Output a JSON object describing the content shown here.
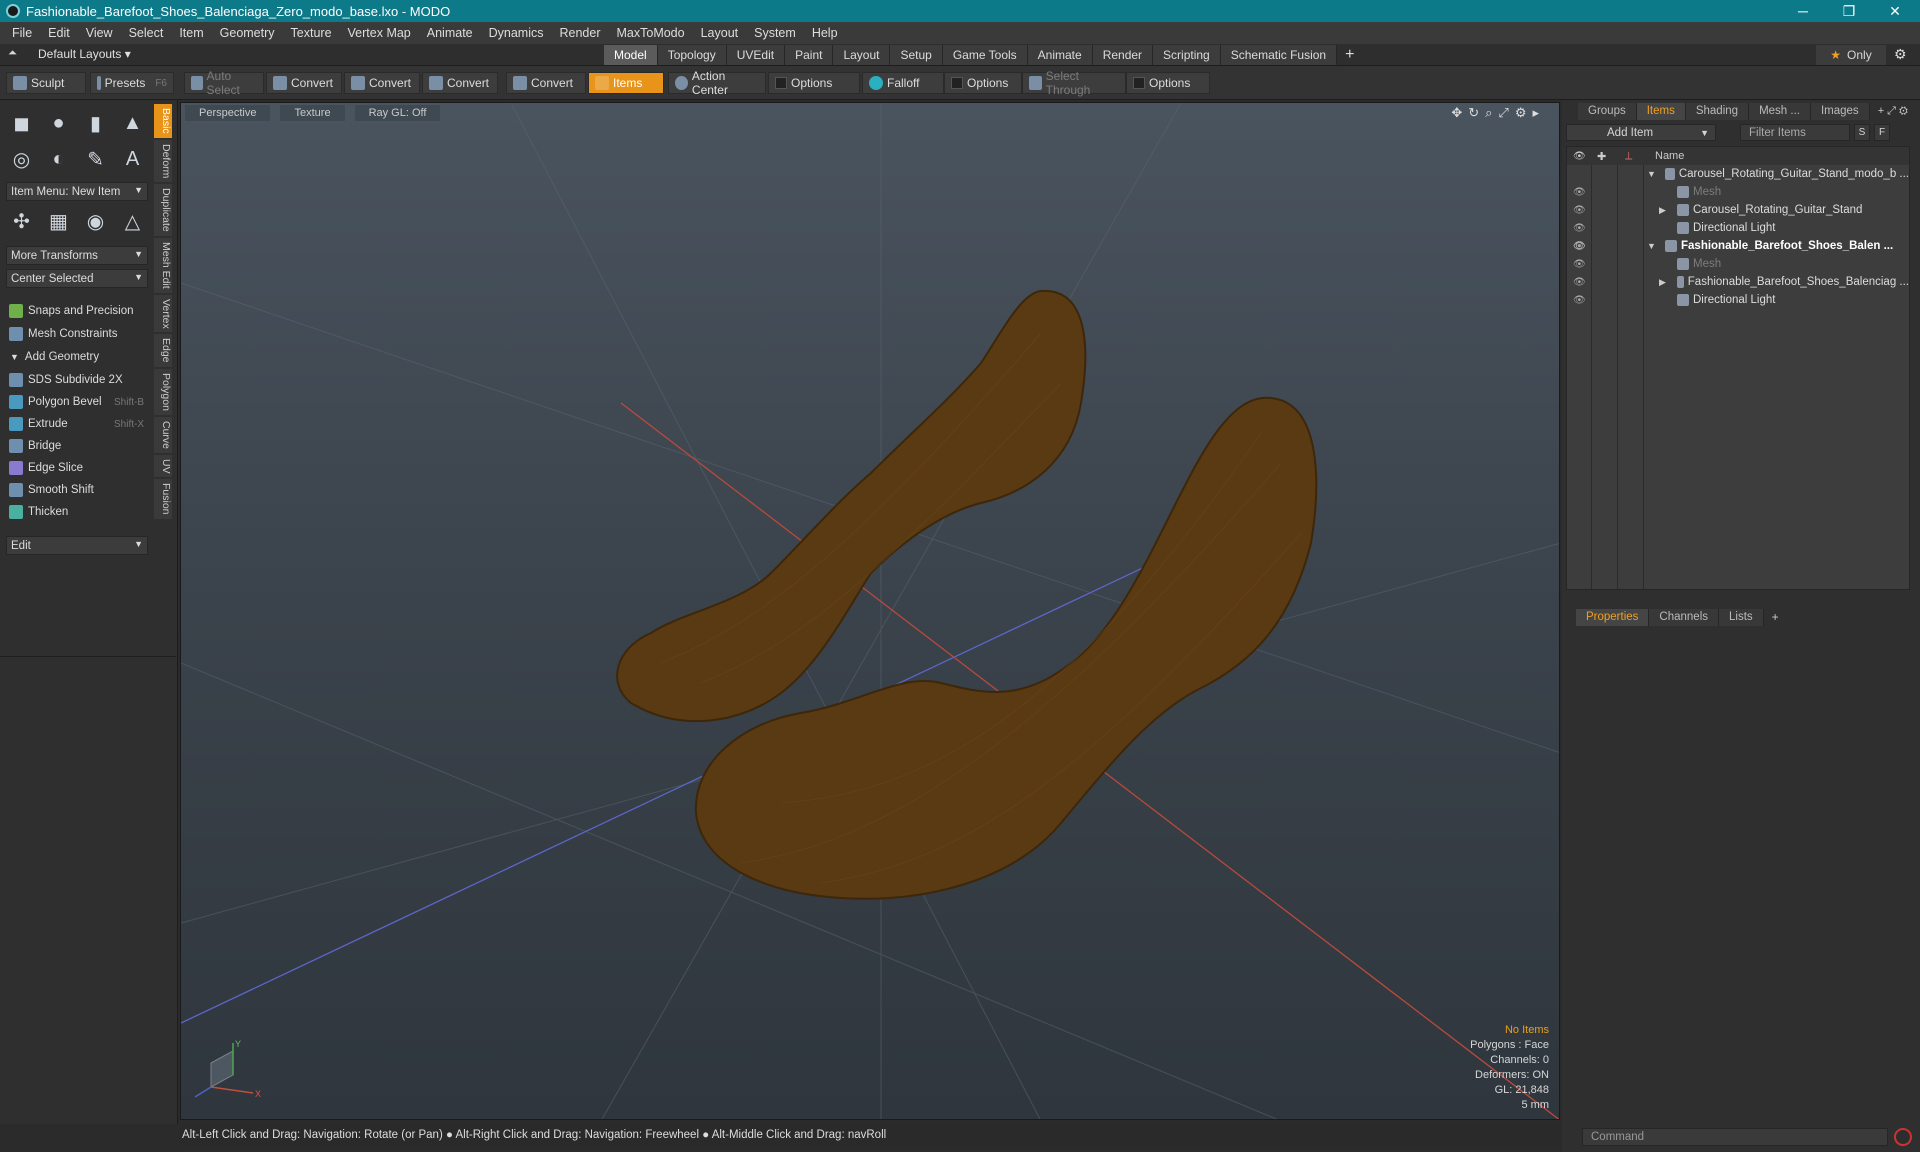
{
  "window": {
    "title": "Fashionable_Barefoot_Shoes_Balenciaga_Zero_modo_base.lxo - MODO",
    "minimize": "─",
    "restore": "❐",
    "close": "✕"
  },
  "menu": [
    "File",
    "Edit",
    "View",
    "Select",
    "Item",
    "Geometry",
    "Texture",
    "Vertex Map",
    "Animate",
    "Dynamics",
    "Render",
    "MaxToModo",
    "Layout",
    "System",
    "Help"
  ],
  "layouts": {
    "label": "Default Layouts ▾"
  },
  "tabs": [
    {
      "label": "Model",
      "active": true
    },
    {
      "label": "Topology"
    },
    {
      "label": "UVEdit"
    },
    {
      "label": "Paint"
    },
    {
      "label": "Layout"
    },
    {
      "label": "Setup"
    },
    {
      "label": "Game Tools"
    },
    {
      "label": "Animate"
    },
    {
      "label": "Render"
    },
    {
      "label": "Scripting"
    },
    {
      "label": "Schematic Fusion"
    }
  ],
  "only": {
    "label": "Only"
  },
  "toolbar": {
    "sculpt": "Sculpt",
    "presets": "Presets",
    "presets_key": "F6",
    "auto_select": "Auto Select",
    "convert1": "Convert",
    "convert2": "Convert",
    "convert3": "Convert",
    "convert4": "Convert",
    "items": "Items",
    "action_center": "Action Center",
    "options1": "Options",
    "falloff": "Falloff",
    "options2": "Options",
    "select_through": "Select Through",
    "options3": "Options"
  },
  "left": {
    "item_menu": "Item Menu: New Item",
    "more_transforms": "More Transforms",
    "center_selected": "Center Selected",
    "snaps": "Snaps and Precision",
    "mesh_constraints": "Mesh Constraints",
    "add_geometry": "Add Geometry",
    "tools": [
      {
        "label": "SDS Subdivide 2X",
        "shortcut": ""
      },
      {
        "label": "Polygon Bevel",
        "shortcut": "Shift-B"
      },
      {
        "label": "Extrude",
        "shortcut": "Shift-X"
      },
      {
        "label": "Bridge",
        "shortcut": ""
      },
      {
        "label": "Edge Slice",
        "shortcut": ""
      },
      {
        "label": "Smooth Shift",
        "shortcut": ""
      },
      {
        "label": "Thicken",
        "shortcut": ""
      }
    ],
    "edit": "Edit",
    "sidetabs": [
      "Basic",
      "Deform",
      "Duplicate",
      "Mesh Edit",
      "Vertex",
      "Edge",
      "Polygon",
      "Curve",
      "UV",
      "Fusion"
    ]
  },
  "viewport": {
    "view": "Perspective",
    "shading": "Texture",
    "raygl": "Ray GL: Off",
    "stats": {
      "items": "No Items",
      "polygons": "Polygons : Face",
      "channels": "Channels: 0",
      "deformers": "Deformers: ON",
      "gl": "GL: 21,848",
      "scale": "5 mm"
    },
    "axis_y": "Y",
    "axis_x": "X",
    "mesh_color": "#5a3a12"
  },
  "status": "Alt-Left Click and Drag: Navigation: Rotate (or Pan) ● Alt-Right Click and Drag: Navigation: Freewheel ● Alt-Middle Click and Drag: navRoll",
  "right": {
    "tabs": [
      "Groups",
      "Items",
      "Shading",
      "Mesh ...",
      "Images"
    ],
    "add_item": "Add Item",
    "filter": "Filter Items",
    "s": "S",
    "f": "F",
    "name_col": "Name",
    "rows": [
      {
        "label": "Carousel_Rotating_Guitar_Stand_modo_b ...",
        "indent": 0,
        "eye": "",
        "expand": "▼"
      },
      {
        "label": "Mesh",
        "indent": 1,
        "eye": "👁",
        "grey": true
      },
      {
        "label": "Carousel_Rotating_Guitar_Stand",
        "indent": 1,
        "eye": "👁",
        "expand": "▶"
      },
      {
        "label": "Directional Light",
        "indent": 1,
        "eye": "👁"
      },
      {
        "label": "Fashionable_Barefoot_Shoes_Balen ...",
        "indent": 0,
        "eye": "👁",
        "expand": "▼",
        "sel": true
      },
      {
        "label": "Mesh",
        "indent": 1,
        "eye": "👁",
        "grey": true
      },
      {
        "label": "Fashionable_Barefoot_Shoes_Balenciag ...",
        "indent": 1,
        "eye": "👁",
        "expand": "▶"
      },
      {
        "label": "Directional Light",
        "indent": 1,
        "eye": "👁"
      }
    ],
    "props_tabs": [
      "Properties",
      "Channels",
      "Lists"
    ],
    "command": "Command"
  }
}
